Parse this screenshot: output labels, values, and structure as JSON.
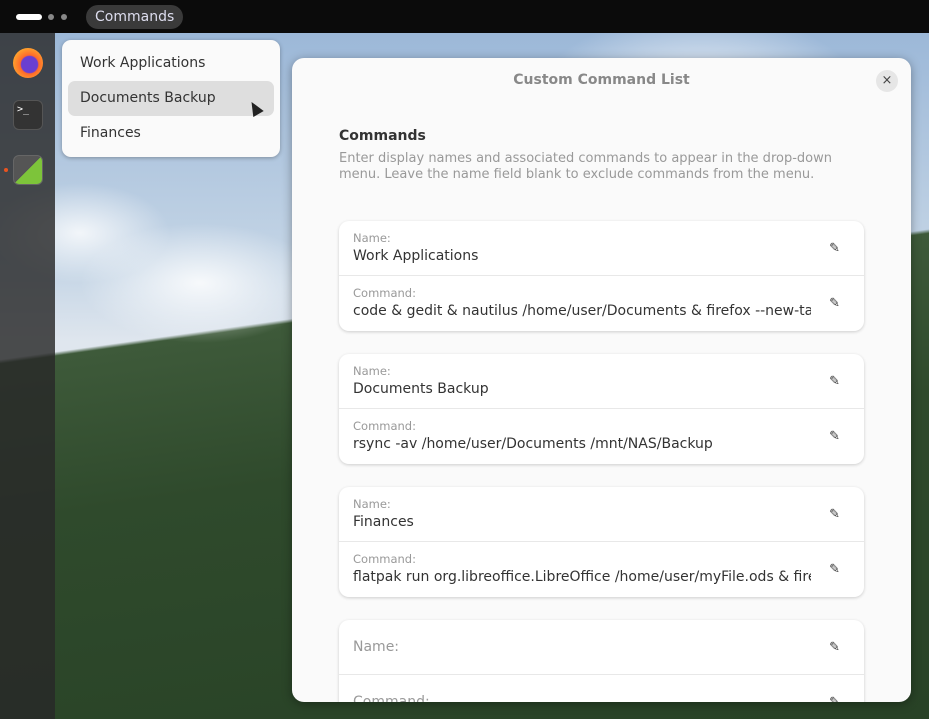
{
  "topbar": {
    "indicator_label": "Commands"
  },
  "dock": {
    "items": [
      "firefox",
      "terminal",
      "extensions"
    ]
  },
  "menu": {
    "items": [
      "Work Applications",
      "Documents Backup",
      "Finances"
    ],
    "highlighted": 1
  },
  "dialog": {
    "title": "Custom Command List",
    "close": "×",
    "heading": "Commands",
    "description": "Enter display names and associated commands to appear in the drop-down menu. Leave the name field blank to exclude commands from the menu.",
    "name_label": "Name:",
    "command_label": "Command:",
    "entries": [
      {
        "name": "Work Applications",
        "command": "code & gedit & nautilus /home/user/Documents & firefox --new-tab www"
      },
      {
        "name": "Documents Backup",
        "command": "rsync -av /home/user/Documents /mnt/NAS/Backup"
      },
      {
        "name": "Finances",
        "command": "flatpak run org.libreoffice.LibreOffice /home/user/myFile.ods & firefox"
      }
    ]
  }
}
